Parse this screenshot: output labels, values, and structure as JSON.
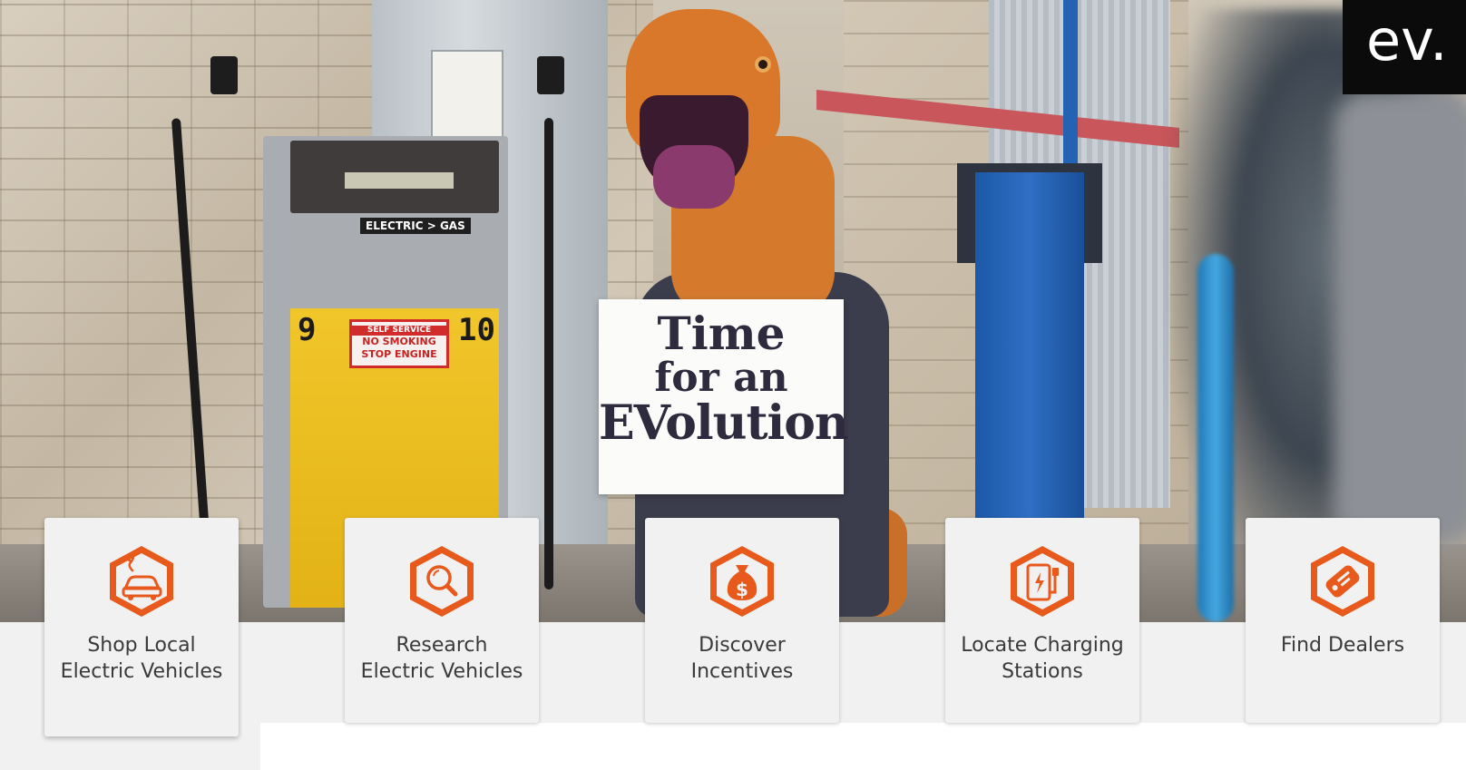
{
  "logo": {
    "text": "ev."
  },
  "hero": {
    "sign_lines": [
      "Time",
      "for an",
      "EVolution"
    ],
    "pump_label": "ELECTRIC > GAS",
    "pump_numbers": [
      "9",
      "10"
    ],
    "pump_sticker": [
      "SELF SERVICE",
      "NO SMOKING",
      "STOP ENGINE"
    ]
  },
  "theme": {
    "accent": "#e8591c",
    "card_bg": "#f1f1f1",
    "text": "#3a3a3a"
  },
  "cards": [
    {
      "label": "Shop Local Electric Vehicles",
      "icon": "electric-car-icon"
    },
    {
      "label": "Research Electric Vehicles",
      "icon": "magnifier-icon"
    },
    {
      "label": "Discover Incentives",
      "icon": "money-bag-icon"
    },
    {
      "label": "Locate Charging Stations",
      "icon": "charging-station-icon"
    },
    {
      "label": "Find Dealers",
      "icon": "dealer-tag-icon"
    }
  ]
}
